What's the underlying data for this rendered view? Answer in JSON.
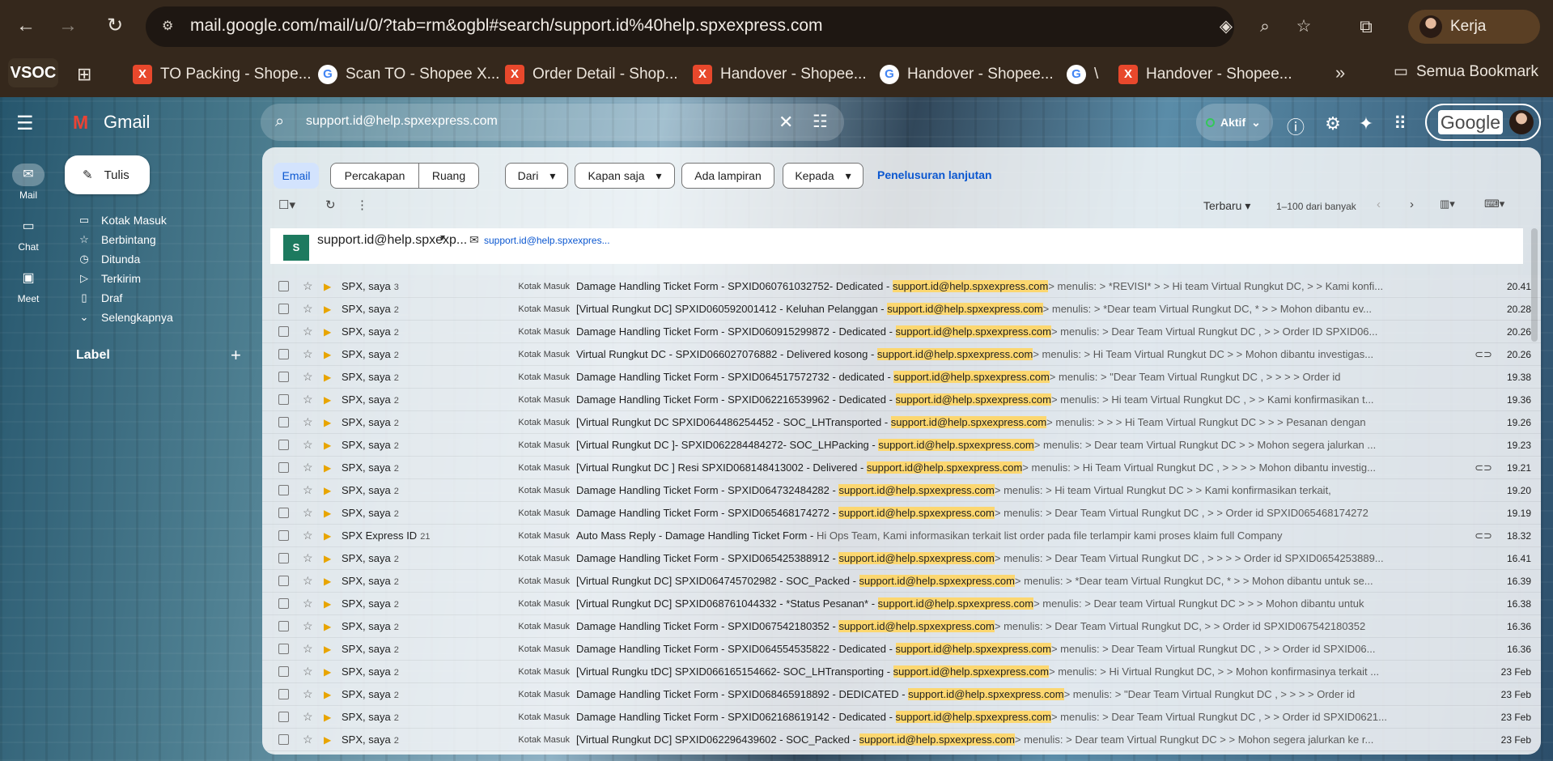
{
  "browser": {
    "url": "mail.google.com/mail/u/0/?tab=rm&ogbl#search/support.id%40help.spxexpress.com",
    "profile_name": "Kerja",
    "icons": [
      "back-icon",
      "forward-icon",
      "reload-icon",
      "tune-icon",
      "lens-icon",
      "zoom-icon",
      "star-icon",
      "extensions-icon"
    ]
  },
  "bookmarks": {
    "vsoc": "VSOC",
    "items": [
      {
        "label": "TO Packing - Shope...",
        "icon": "shopee-icon"
      },
      {
        "label": "Scan TO - Shopee X...",
        "icon": "google-icon"
      },
      {
        "label": "Order Detail - Shop...",
        "icon": "shopee-icon"
      },
      {
        "label": "Handover - Shopee...",
        "icon": "shopee-icon"
      },
      {
        "label": "Handover - Shopee...",
        "icon": "google-icon"
      },
      {
        "label": "\\",
        "icon": "google-icon"
      },
      {
        "label": "Handover - Shopee...",
        "icon": "shopee-icon"
      }
    ],
    "more": "»",
    "folder": "Semua Bookmark"
  },
  "rail": {
    "mail": "Mail",
    "chat": "Chat",
    "meet": "Meet"
  },
  "gmail": {
    "logo_text": "Gmail",
    "compose": "Tulis",
    "nav": [
      "Kotak Masuk",
      "Berbintang",
      "Ditunda",
      "Terkirim",
      "Draf",
      "Selengkapnya"
    ],
    "labels_title": "Label",
    "search_value": "support.id@help.spxexpress.com",
    "status": "Aktif",
    "google_word": "Google"
  },
  "filters": {
    "chips": [
      "Email",
      "Percakapan",
      "Ruang"
    ],
    "dropdowns": [
      "Dari",
      "Kapan saja",
      "Ada lampiran",
      "Kepada"
    ],
    "advanced": "Penelusuran lanjutan"
  },
  "toolbar": {
    "sort": "Terbaru",
    "range": "1–100 dari banyak"
  },
  "person": {
    "initial": "S",
    "name": "support.id@help.spxexp...",
    "email": "support.id@help.spxexpres..."
  },
  "highlight": "support.id@help.spxexpress.com",
  "emails": [
    {
      "from": "SPX, saya",
      "count": "3",
      "label": "Kotak Masuk",
      "subject": "Damage Handling Ticket Form - SPXID060761032752- Dedicated - ",
      "snippet": "> menulis: > *REVISI* > > Hi team Virtual Rungkut DC, > > Kami konfi...",
      "attach": false,
      "time": "20.41"
    },
    {
      "from": "SPX, saya",
      "count": "2",
      "label": "Kotak Masuk",
      "subject": "[Virtual Rungkut DC] SPXID060592001412 - Keluhan Pelanggan - ",
      "snippet": "> menulis: > *Dear team Virtual Rungkut DC, * > > Mohon dibantu ev...",
      "attach": false,
      "time": "20.28"
    },
    {
      "from": "SPX, saya",
      "count": "2",
      "label": "Kotak Masuk",
      "subject": "Damage Handling Ticket Form - SPXID060915299872 - Dedicated - ",
      "snippet": "> menulis: > Dear Team Virtual Rungkut DC , > > Order ID SPXID06...",
      "attach": false,
      "time": "20.26"
    },
    {
      "from": "SPX, saya",
      "count": "2",
      "label": "Kotak Masuk",
      "subject": "Virtual Rungkut DC - SPXID066027076882 - Delivered kosong - ",
      "snippet": "> menulis: > Hi Team Virtual Rungkut DC > > Mohon dibantu investigas...",
      "attach": true,
      "time": "20.26"
    },
    {
      "from": "SPX, saya",
      "count": "2",
      "label": "Kotak Masuk",
      "subject": "Damage Handling Ticket Form - SPXID064517572732 - dedicated - ",
      "snippet": "> menulis: > \"Dear Team Virtual Rungkut DC , > > > > Order id",
      "attach": false,
      "time": "19.38"
    },
    {
      "from": "SPX, saya",
      "count": "2",
      "label": "Kotak Masuk",
      "subject": "Damage Handling Ticket Form - SPXID062216539962 - Dedicated - ",
      "snippet": "> menulis: > Hi team Virtual Rungkut DC , > > Kami konfirmasikan t...",
      "attach": false,
      "time": "19.36"
    },
    {
      "from": "SPX, saya",
      "count": "2",
      "label": "Kotak Masuk",
      "subject": "[Virtual Rungkut DC  SPXID064486254452 - SOC_LHTransported - ",
      "snippet": "> menulis: > > > Hi Team Virtual Rungkut DC > > > Pesanan dengan",
      "attach": false,
      "time": "19.26"
    },
    {
      "from": "SPX, saya",
      "count": "2",
      "label": "Kotak Masuk",
      "subject": "[Virtual Rungkut DC ]- SPXID062284484272- SOC_LHPacking - ",
      "snippet": "> menulis: > Dear team Virtual Rungkut DC > > Mohon segera jalurkan ...",
      "attach": false,
      "time": "19.23"
    },
    {
      "from": "SPX, saya",
      "count": "2",
      "label": "Kotak Masuk",
      "subject": "[Virtual Rungkut DC ] Resi SPXID068148413002 - Delivered - ",
      "snippet": "> menulis: > Hi Team Virtual Rungkut DC , > > > > Mohon dibantu investig...",
      "attach": true,
      "time": "19.21"
    },
    {
      "from": "SPX, saya",
      "count": "2",
      "label": "Kotak Masuk",
      "subject": "Damage Handling Ticket Form - SPXID064732484282 - ",
      "snippet": "> menulis: > Hi team Virtual Rungkut DC > > Kami konfirmasikan terkait,",
      "attach": false,
      "time": "19.20"
    },
    {
      "from": "SPX, saya",
      "count": "2",
      "label": "Kotak Masuk",
      "subject": "Damage Handling Ticket Form - SPXID065468174272 - ",
      "snippet": "> menulis: > Dear Team Virtual Rungkut DC , > > Order id SPXID065468174272",
      "attach": false,
      "time": "19.19"
    },
    {
      "from": "SPX Express ID",
      "count": "21",
      "label": "Kotak Masuk",
      "subject": "Auto Mass Reply - Damage Handling Ticket Form - ",
      "snippet": "Hi Ops Team, Kami informasikan terkait list order pada file terlampir kami proses klaim full Company",
      "attach": true,
      "time": "18.32"
    },
    {
      "from": "SPX, saya",
      "count": "2",
      "label": "Kotak Masuk",
      "subject": "Damage Handling Ticket Form - SPXID065425388912 - ",
      "snippet": "> menulis: > Dear Team Virtual Rungkut DC , > > > > Order id SPXID0654253889...",
      "attach": false,
      "time": "16.41"
    },
    {
      "from": "SPX, saya",
      "count": "2",
      "label": "Kotak Masuk",
      "subject": "[Virtual Rungkut DC] SPXID064745702982 - SOC_Packed - ",
      "snippet": "> menulis: > *Dear team Virtual Rungkut DC, * > > Mohon dibantu untuk se...",
      "attach": false,
      "time": "16.39"
    },
    {
      "from": "SPX, saya",
      "count": "2",
      "label": "Kotak Masuk",
      "subject": "[Virtual Rungkut DC] SPXID068761044332 - *Status Pesanan* - ",
      "snippet": "> menulis: > Dear team Virtual Rungkut DC > > > Mohon dibantu untuk",
      "attach": false,
      "time": "16.38"
    },
    {
      "from": "SPX, saya",
      "count": "2",
      "label": "Kotak Masuk",
      "subject": "Damage Handling Ticket Form - SPXID067542180352 - ",
      "snippet": "> menulis: > Dear Team Virtual Rungkut DC, > > Order id SPXID067542180352",
      "attach": false,
      "time": "16.36"
    },
    {
      "from": "SPX, saya",
      "count": "2",
      "label": "Kotak Masuk",
      "subject": "Damage Handling Ticket Form - SPXID064554535822 - Dedicated - ",
      "snippet": "> menulis: > Dear Team Virtual Rungkut DC , > > Order id SPXID06...",
      "attach": false,
      "time": "16.36"
    },
    {
      "from": "SPX, saya",
      "count": "2",
      "label": "Kotak Masuk",
      "subject": "[Virtual Rungku tDC] SPXID066165154662- SOC_LHTransporting - ",
      "snippet": "> menulis: > Hi Virtual Rungkut DC, > > Mohon konfirmasinya terkait ...",
      "attach": false,
      "time": "23 Feb"
    },
    {
      "from": "SPX, saya",
      "count": "2",
      "label": "Kotak Masuk",
      "subject": "Damage Handling Ticket Form - SPXID068465918892 - DEDICATED - ",
      "snippet": "> menulis: > \"Dear Team Virtual Rungkut DC , > > > > Order id",
      "attach": false,
      "time": "23 Feb"
    },
    {
      "from": "SPX, saya",
      "count": "2",
      "label": "Kotak Masuk",
      "subject": "Damage Handling Ticket Form - SPXID062168619142 - Dedicated - ",
      "snippet": "> menulis: > Dear Team Virtual Rungkut DC , > > Order id SPXID0621...",
      "attach": false,
      "time": "23 Feb"
    },
    {
      "from": "SPX, saya",
      "count": "2",
      "label": "Kotak Masuk",
      "subject": "[Virtual Rungkut DC] SPXID062296439602 - SOC_Packed - ",
      "snippet": "> menulis: > Dear team Virtual Rungkut DC > > Mohon segera jalurkan ke r...",
      "attach": false,
      "time": "23 Feb"
    }
  ]
}
